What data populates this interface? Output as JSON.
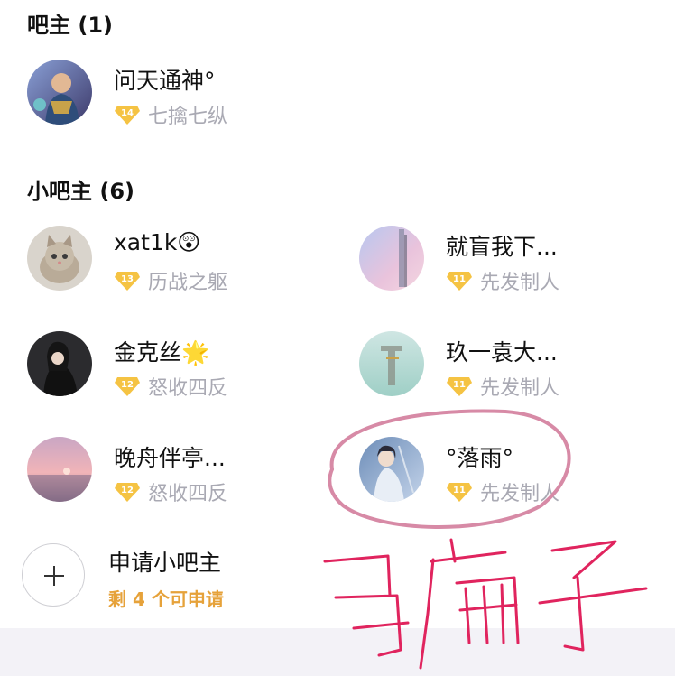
{
  "owner_section": {
    "title": "吧主 (1)"
  },
  "owner": {
    "name": "问天通神°",
    "level": "14",
    "level_title": "七擒七纵",
    "avatar_icon": "avatar-warrior"
  },
  "sub_section": {
    "title": "小吧主 (6)"
  },
  "sub_owners": [
    {
      "name": "xat1k😲",
      "level": "13",
      "level_title": "历战之躯",
      "avatar_icon": "avatar-kitten"
    },
    {
      "name": "就盲我下...",
      "level": "11",
      "level_title": "先发制人",
      "avatar_icon": "avatar-pastel-sky"
    },
    {
      "name": "金克丝🌟",
      "level": "12",
      "level_title": "怒收四反",
      "avatar_icon": "avatar-girl"
    },
    {
      "name": "玖一袁大...",
      "level": "11",
      "level_title": "先发制人",
      "avatar_icon": "avatar-letter"
    },
    {
      "name": "晚舟伴亭...",
      "level": "12",
      "level_title": "怒收四反",
      "avatar_icon": "avatar-sunset"
    },
    {
      "name": "°落雨°",
      "level": "11",
      "level_title": "先发制人",
      "avatar_icon": "avatar-swordsman"
    }
  ],
  "apply": {
    "label": "申请小吧主",
    "remaining": "剩 4 个可申请",
    "icon": "plus-icon"
  },
  "colors": {
    "badge": "#f5c343",
    "accent": "#e6a23a",
    "annotation": "#e0245e",
    "highlight_circle": "#d78aa6"
  }
}
